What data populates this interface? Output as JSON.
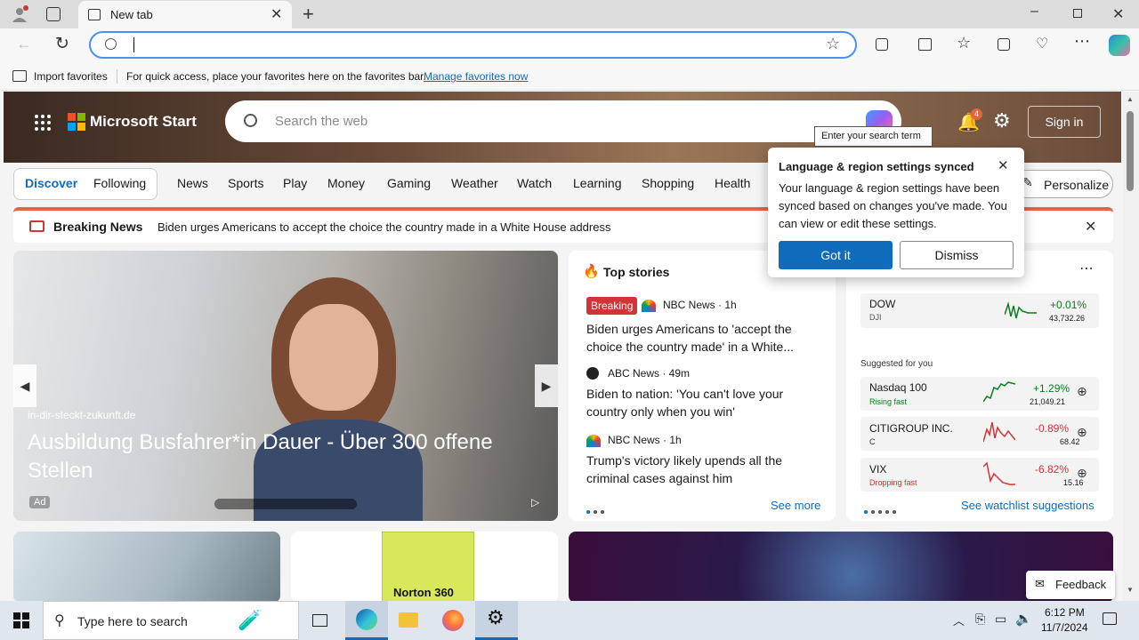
{
  "browser": {
    "tab_title": "New tab",
    "import_favorites": "Import favorites",
    "favorites_hint": "For quick access, place your favorites here on the favorites bar.",
    "manage_favorites": "Manage favorites now"
  },
  "header": {
    "brand": "Microsoft Start",
    "search_placeholder": "Search the web",
    "search_tooltip": "Enter your search term",
    "notification_count": "4",
    "sign_in": "Sign in"
  },
  "nav": {
    "discover": "Discover",
    "following": "Following",
    "items": [
      "News",
      "Sports",
      "Play",
      "Money",
      "Gaming",
      "Weather",
      "Watch",
      "Learning",
      "Shopping",
      "Health"
    ],
    "personalize": "Personalize"
  },
  "breaking": {
    "label": "Breaking News",
    "text": "Biden urges Americans to accept the choice the country made in a White House address"
  },
  "hero": {
    "source": "in-dir-steckt-zukunft.de",
    "title": "Ausbildung Busfahrer*in Dauer - Über 300 offene Stellen",
    "ad_badge": "Ad"
  },
  "top_stories": {
    "heading": "Top stories",
    "stories": [
      {
        "badge": "Breaking",
        "source": "NBC News · 1h",
        "headline": "Biden urges Americans to 'accept the choice the country made' in a White..."
      },
      {
        "source": "ABC News · 49m",
        "headline": "Biden to nation: 'You can't love your country only when you win'"
      },
      {
        "source": "NBC News · 1h",
        "headline": "Trump's victory likely upends all the criminal cases against him"
      }
    ],
    "see_more": "See more"
  },
  "popup": {
    "title": "Language & region settings synced",
    "body": "Your language & region settings have been synced based on changes you've made. You can view or edit these settings.",
    "got_it": "Got it",
    "dismiss": "Dismiss"
  },
  "markets": {
    "dow": {
      "name": "DOW",
      "symbol": "DJI",
      "change": "+0.01%",
      "value": "43,732.26"
    },
    "suggested_label": "Suggested for you",
    "suggested": [
      {
        "name": "Nasdaq 100",
        "sub": "Rising fast",
        "change": "+1.29%",
        "value": "21,049.21",
        "color": "#0a7d1e"
      },
      {
        "name": "CITIGROUP INC.",
        "sub": "C",
        "change": "-0.89%",
        "value": "68.42",
        "color": "#d13438"
      },
      {
        "name": "VIX",
        "sub": "Dropping fast",
        "change": "-6.82%",
        "value": "15.16",
        "color": "#d13438"
      }
    ],
    "watchlist_link": "See watchlist suggestions"
  },
  "bottom": {
    "product_label": "Norton 360",
    "feedback": "Feedback"
  },
  "taskbar": {
    "search_placeholder": "Type here to search",
    "time": "6:12 PM",
    "date": "11/7/2024"
  }
}
